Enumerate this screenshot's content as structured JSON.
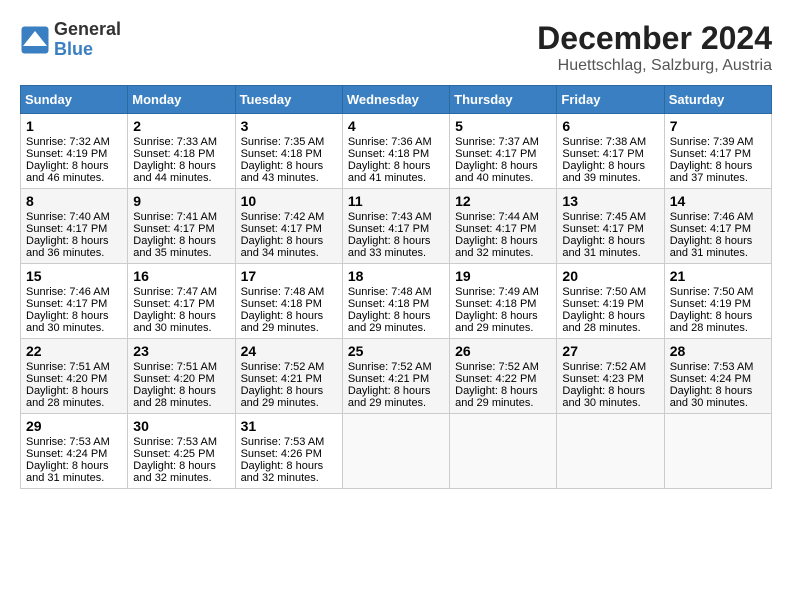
{
  "logo": {
    "line1": "General",
    "line2": "Blue"
  },
  "title": "December 2024",
  "subtitle": "Huettschlag, Salzburg, Austria",
  "days_of_week": [
    "Sunday",
    "Monday",
    "Tuesday",
    "Wednesday",
    "Thursday",
    "Friday",
    "Saturday"
  ],
  "weeks": [
    [
      {
        "day": "1",
        "sunrise": "Sunrise: 7:32 AM",
        "sunset": "Sunset: 4:19 PM",
        "daylight": "Daylight: 8 hours and 46 minutes."
      },
      {
        "day": "2",
        "sunrise": "Sunrise: 7:33 AM",
        "sunset": "Sunset: 4:18 PM",
        "daylight": "Daylight: 8 hours and 44 minutes."
      },
      {
        "day": "3",
        "sunrise": "Sunrise: 7:35 AM",
        "sunset": "Sunset: 4:18 PM",
        "daylight": "Daylight: 8 hours and 43 minutes."
      },
      {
        "day": "4",
        "sunrise": "Sunrise: 7:36 AM",
        "sunset": "Sunset: 4:18 PM",
        "daylight": "Daylight: 8 hours and 41 minutes."
      },
      {
        "day": "5",
        "sunrise": "Sunrise: 7:37 AM",
        "sunset": "Sunset: 4:17 PM",
        "daylight": "Daylight: 8 hours and 40 minutes."
      },
      {
        "day": "6",
        "sunrise": "Sunrise: 7:38 AM",
        "sunset": "Sunset: 4:17 PM",
        "daylight": "Daylight: 8 hours and 39 minutes."
      },
      {
        "day": "7",
        "sunrise": "Sunrise: 7:39 AM",
        "sunset": "Sunset: 4:17 PM",
        "daylight": "Daylight: 8 hours and 37 minutes."
      }
    ],
    [
      {
        "day": "8",
        "sunrise": "Sunrise: 7:40 AM",
        "sunset": "Sunset: 4:17 PM",
        "daylight": "Daylight: 8 hours and 36 minutes."
      },
      {
        "day": "9",
        "sunrise": "Sunrise: 7:41 AM",
        "sunset": "Sunset: 4:17 PM",
        "daylight": "Daylight: 8 hours and 35 minutes."
      },
      {
        "day": "10",
        "sunrise": "Sunrise: 7:42 AM",
        "sunset": "Sunset: 4:17 PM",
        "daylight": "Daylight: 8 hours and 34 minutes."
      },
      {
        "day": "11",
        "sunrise": "Sunrise: 7:43 AM",
        "sunset": "Sunset: 4:17 PM",
        "daylight": "Daylight: 8 hours and 33 minutes."
      },
      {
        "day": "12",
        "sunrise": "Sunrise: 7:44 AM",
        "sunset": "Sunset: 4:17 PM",
        "daylight": "Daylight: 8 hours and 32 minutes."
      },
      {
        "day": "13",
        "sunrise": "Sunrise: 7:45 AM",
        "sunset": "Sunset: 4:17 PM",
        "daylight": "Daylight: 8 hours and 31 minutes."
      },
      {
        "day": "14",
        "sunrise": "Sunrise: 7:46 AM",
        "sunset": "Sunset: 4:17 PM",
        "daylight": "Daylight: 8 hours and 31 minutes."
      }
    ],
    [
      {
        "day": "15",
        "sunrise": "Sunrise: 7:46 AM",
        "sunset": "Sunset: 4:17 PM",
        "daylight": "Daylight: 8 hours and 30 minutes."
      },
      {
        "day": "16",
        "sunrise": "Sunrise: 7:47 AM",
        "sunset": "Sunset: 4:17 PM",
        "daylight": "Daylight: 8 hours and 30 minutes."
      },
      {
        "day": "17",
        "sunrise": "Sunrise: 7:48 AM",
        "sunset": "Sunset: 4:18 PM",
        "daylight": "Daylight: 8 hours and 29 minutes."
      },
      {
        "day": "18",
        "sunrise": "Sunrise: 7:48 AM",
        "sunset": "Sunset: 4:18 PM",
        "daylight": "Daylight: 8 hours and 29 minutes."
      },
      {
        "day": "19",
        "sunrise": "Sunrise: 7:49 AM",
        "sunset": "Sunset: 4:18 PM",
        "daylight": "Daylight: 8 hours and 29 minutes."
      },
      {
        "day": "20",
        "sunrise": "Sunrise: 7:50 AM",
        "sunset": "Sunset: 4:19 PM",
        "daylight": "Daylight: 8 hours and 28 minutes."
      },
      {
        "day": "21",
        "sunrise": "Sunrise: 7:50 AM",
        "sunset": "Sunset: 4:19 PM",
        "daylight": "Daylight: 8 hours and 28 minutes."
      }
    ],
    [
      {
        "day": "22",
        "sunrise": "Sunrise: 7:51 AM",
        "sunset": "Sunset: 4:20 PM",
        "daylight": "Daylight: 8 hours and 28 minutes."
      },
      {
        "day": "23",
        "sunrise": "Sunrise: 7:51 AM",
        "sunset": "Sunset: 4:20 PM",
        "daylight": "Daylight: 8 hours and 28 minutes."
      },
      {
        "day": "24",
        "sunrise": "Sunrise: 7:52 AM",
        "sunset": "Sunset: 4:21 PM",
        "daylight": "Daylight: 8 hours and 29 minutes."
      },
      {
        "day": "25",
        "sunrise": "Sunrise: 7:52 AM",
        "sunset": "Sunset: 4:21 PM",
        "daylight": "Daylight: 8 hours and 29 minutes."
      },
      {
        "day": "26",
        "sunrise": "Sunrise: 7:52 AM",
        "sunset": "Sunset: 4:22 PM",
        "daylight": "Daylight: 8 hours and 29 minutes."
      },
      {
        "day": "27",
        "sunrise": "Sunrise: 7:52 AM",
        "sunset": "Sunset: 4:23 PM",
        "daylight": "Daylight: 8 hours and 30 minutes."
      },
      {
        "day": "28",
        "sunrise": "Sunrise: 7:53 AM",
        "sunset": "Sunset: 4:24 PM",
        "daylight": "Daylight: 8 hours and 30 minutes."
      }
    ],
    [
      {
        "day": "29",
        "sunrise": "Sunrise: 7:53 AM",
        "sunset": "Sunset: 4:24 PM",
        "daylight": "Daylight: 8 hours and 31 minutes."
      },
      {
        "day": "30",
        "sunrise": "Sunrise: 7:53 AM",
        "sunset": "Sunset: 4:25 PM",
        "daylight": "Daylight: 8 hours and 32 minutes."
      },
      {
        "day": "31",
        "sunrise": "Sunrise: 7:53 AM",
        "sunset": "Sunset: 4:26 PM",
        "daylight": "Daylight: 8 hours and 32 minutes."
      },
      null,
      null,
      null,
      null
    ]
  ]
}
